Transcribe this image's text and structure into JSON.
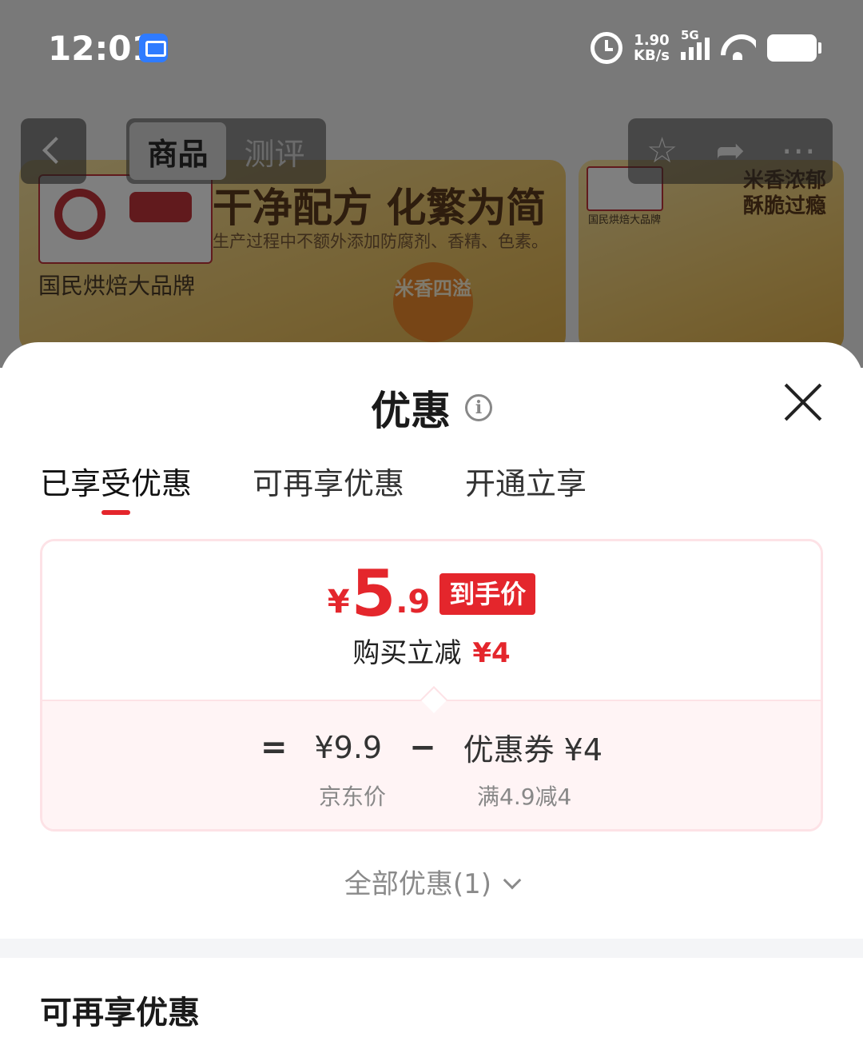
{
  "status_bar": {
    "time": "12:01",
    "net_speed_value": "1.90",
    "net_speed_unit": "KB/s",
    "network": "5G",
    "icons": [
      "screen-record-icon",
      "alarm-icon",
      "signal-icon",
      "wifi-icon",
      "battery-icon"
    ]
  },
  "nav": {
    "tabs": [
      "商品",
      "测评"
    ],
    "active_tab": "商品",
    "actions": [
      "star-icon",
      "share-icon",
      "more-icon"
    ]
  },
  "banners": [
    {
      "brand_text": "国民烘焙大品牌",
      "headline": "干净配方 化繁为简",
      "subtext": "生产过程中不额外添加防腐剂、香精、色素。",
      "badge": "米香四溢"
    },
    {
      "brand_text": "国民烘焙大品牌",
      "headline_line1": "米香浓郁",
      "headline_line2": "酥脆过瘾"
    }
  ],
  "sheet": {
    "title": "优惠",
    "tabs": [
      {
        "label": "已享受优惠",
        "active": true
      },
      {
        "label": "可再享优惠",
        "active": false
      },
      {
        "label": "开通立享",
        "active": false
      }
    ],
    "card": {
      "currency": "¥",
      "price_int": "5",
      "price_dec": ".9",
      "price_tag": "到手价",
      "save_label": "购买立减",
      "save_amount": "¥4",
      "formula": {
        "equals": "=",
        "base_price": "¥9.9",
        "minus": "−",
        "coupon": "优惠券 ¥4",
        "base_label": "京东价",
        "coupon_label": "满4.9减4"
      }
    },
    "all_discounts": "全部优惠(1)",
    "section_title": "可再享优惠"
  },
  "colors": {
    "accent": "#e4262c",
    "card_border": "#fde2e6",
    "card_bottom_bg": "#fff4f5"
  }
}
